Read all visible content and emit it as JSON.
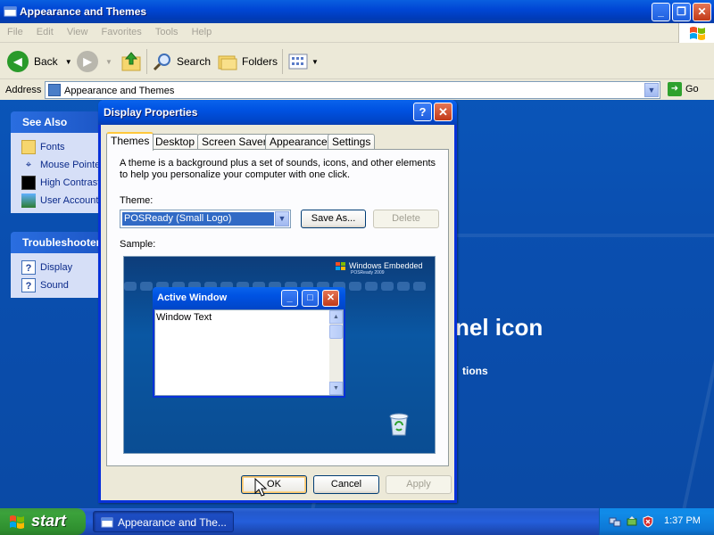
{
  "explorer": {
    "title": "Appearance and Themes",
    "menu": [
      "File",
      "Edit",
      "View",
      "Favorites",
      "Tools",
      "Help"
    ],
    "toolbar": {
      "back": "Back",
      "search": "Search",
      "folders": "Folders"
    },
    "address": {
      "label": "Address",
      "value": "Appearance and Themes",
      "go": "Go"
    },
    "see_also": {
      "title": "See Also",
      "items": [
        "Fonts",
        "Mouse Pointers",
        "High Contrast",
        "User Account Picture"
      ]
    },
    "troubleshooters": {
      "title": "Troubleshooters",
      "items": [
        "Display",
        "Sound"
      ]
    },
    "background_text": {
      "heading": "nel icon",
      "sub": "tions"
    }
  },
  "dialog": {
    "title": "Display Properties",
    "tabs": [
      "Themes",
      "Desktop",
      "Screen Saver",
      "Appearance",
      "Settings"
    ],
    "active_tab": "Themes",
    "description": "A theme is a background plus a set of sounds, icons, and other elements to help you personalize your computer with one click.",
    "theme_label": "Theme:",
    "theme_value": "POSReady (Small Logo)",
    "save_as": "Save As...",
    "delete": "Delete",
    "sample_label": "Sample:",
    "sample": {
      "brand": "Windows Embedded",
      "brand_sub": "POSReady 2009",
      "window_title": "Active Window",
      "window_text": "Window Text"
    },
    "ok": "OK",
    "cancel": "Cancel",
    "apply": "Apply"
  },
  "taskbar": {
    "start": "start",
    "task": "Appearance and The...",
    "clock": "1:37 PM"
  },
  "colors": {
    "title_blue": "#0052e2",
    "close_red": "#c23a18",
    "start_green": "#3ba23b",
    "tray_blue": "#118be8",
    "link_blue": "#0b2a8a"
  },
  "icons": {
    "title_icon": "folder-window-icon",
    "back": "back-arrow-icon",
    "forward": "forward-arrow-icon",
    "up": "up-folder-icon",
    "search": "magnifier-icon",
    "folders": "folders-icon",
    "views": "views-grid-icon",
    "help": "question-icon",
    "close": "close-x-icon"
  }
}
